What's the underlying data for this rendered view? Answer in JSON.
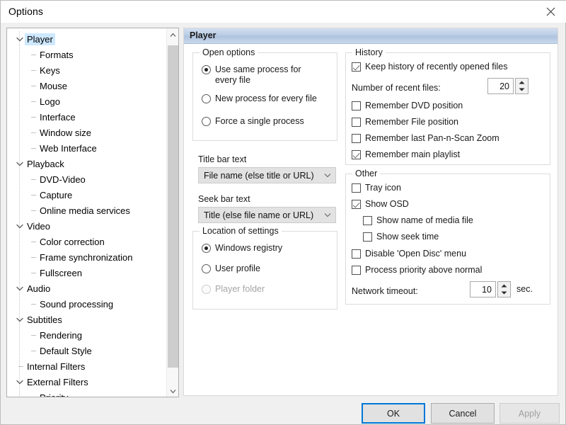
{
  "window": {
    "title": "Options",
    "close_icon": "close-icon"
  },
  "sidebar": {
    "items": [
      {
        "label": "Player",
        "level": 0,
        "expanded": true,
        "selected": true
      },
      {
        "label": "Formats",
        "level": 1,
        "expanded": false,
        "selected": false
      },
      {
        "label": "Keys",
        "level": 1,
        "expanded": false,
        "selected": false
      },
      {
        "label": "Mouse",
        "level": 1,
        "expanded": false,
        "selected": false
      },
      {
        "label": "Logo",
        "level": 1,
        "expanded": false,
        "selected": false
      },
      {
        "label": "Interface",
        "level": 1,
        "expanded": false,
        "selected": false
      },
      {
        "label": "Window size",
        "level": 1,
        "expanded": false,
        "selected": false
      },
      {
        "label": "Web Interface",
        "level": 1,
        "expanded": false,
        "selected": false
      },
      {
        "label": "Playback",
        "level": 0,
        "expanded": true,
        "selected": false
      },
      {
        "label": "DVD-Video",
        "level": 1,
        "expanded": false,
        "selected": false
      },
      {
        "label": "Capture",
        "level": 1,
        "expanded": false,
        "selected": false
      },
      {
        "label": "Online media services",
        "level": 1,
        "expanded": false,
        "selected": false
      },
      {
        "label": "Video",
        "level": 0,
        "expanded": true,
        "selected": false
      },
      {
        "label": "Color correction",
        "level": 1,
        "expanded": false,
        "selected": false
      },
      {
        "label": "Frame synchronization",
        "level": 1,
        "expanded": false,
        "selected": false
      },
      {
        "label": "Fullscreen",
        "level": 1,
        "expanded": false,
        "selected": false
      },
      {
        "label": "Audio",
        "level": 0,
        "expanded": true,
        "selected": false
      },
      {
        "label": "Sound processing",
        "level": 1,
        "expanded": false,
        "selected": false
      },
      {
        "label": "Subtitles",
        "level": 0,
        "expanded": true,
        "selected": false
      },
      {
        "label": "Rendering",
        "level": 1,
        "expanded": false,
        "selected": false
      },
      {
        "label": "Default Style",
        "level": 1,
        "expanded": false,
        "selected": false
      },
      {
        "label": "Internal Filters",
        "level": 0,
        "expanded": false,
        "selected": false
      },
      {
        "label": "External Filters",
        "level": 0,
        "expanded": true,
        "selected": false
      },
      {
        "label": "Priority",
        "level": 1,
        "expanded": false,
        "selected": false
      }
    ],
    "scrollbar": {
      "up_icon": "chevron-up-icon",
      "down_icon": "chevron-down-icon"
    }
  },
  "page": {
    "header": "Player",
    "open_options": {
      "legend": "Open options",
      "radios": [
        {
          "label": "Use same process for every file",
          "checked": true,
          "disabled": false
        },
        {
          "label": "New process for every file",
          "checked": false,
          "disabled": false
        },
        {
          "label": "Force a single process",
          "checked": false,
          "disabled": false
        }
      ]
    },
    "title_bar_text": {
      "label": "Title bar text",
      "value": "File name (else title or URL)",
      "arrow_icon": "chevron-down-icon"
    },
    "seek_bar_text": {
      "label": "Seek bar text",
      "value": "Title (else file name or URL)",
      "arrow_icon": "chevron-down-icon"
    },
    "location_of_settings": {
      "legend": "Location of settings",
      "radios": [
        {
          "label": "Windows registry",
          "checked": true,
          "disabled": false
        },
        {
          "label": "User profile",
          "checked": false,
          "disabled": false
        },
        {
          "label": "Player folder",
          "checked": false,
          "disabled": true
        }
      ]
    },
    "history": {
      "legend": "History",
      "keep_history": {
        "label": "Keep history of recently opened files",
        "checked": true
      },
      "recent_files": {
        "label": "Number of recent files:",
        "value": "20"
      },
      "checks": [
        {
          "label": "Remember DVD position",
          "checked": false
        },
        {
          "label": "Remember File position",
          "checked": false
        },
        {
          "label": "Remember last Pan-n-Scan Zoom",
          "checked": false
        },
        {
          "label": "Remember main playlist",
          "checked": true
        }
      ]
    },
    "other": {
      "legend": "Other",
      "tray_icon": {
        "label": "Tray icon",
        "checked": false
      },
      "show_osd": {
        "label": "Show OSD",
        "checked": true
      },
      "show_name": {
        "label": "Show name of media file",
        "checked": false
      },
      "show_seek": {
        "label": "Show seek time",
        "checked": false
      },
      "disable_disc": {
        "label": "Disable 'Open Disc' menu",
        "checked": false
      },
      "priority": {
        "label": "Process priority above normal",
        "checked": false
      },
      "network_timeout": {
        "label": "Network timeout:",
        "value": "10",
        "unit": "sec."
      }
    }
  },
  "footer": {
    "ok": "OK",
    "cancel": "Cancel",
    "apply": "Apply"
  },
  "colors": {
    "accent": "#0078d7",
    "selection": "#cde8ff",
    "header_gradient_top": "#d3dff0",
    "header_gradient_bottom": "#c9d8ec",
    "window_bg": "#f0f0f0"
  }
}
